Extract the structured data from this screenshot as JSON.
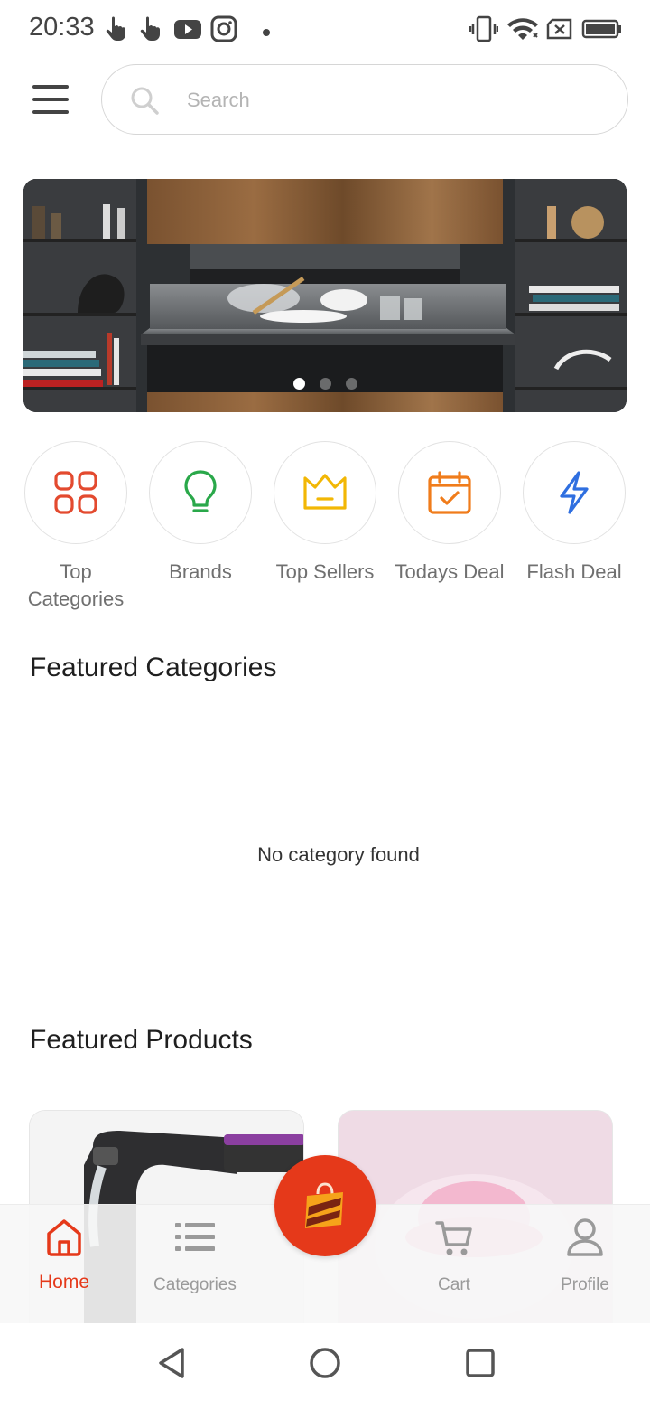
{
  "status_bar": {
    "time": "20:33",
    "left_icons": [
      "touch-icon",
      "touch-icon",
      "youtube-icon",
      "instagram-icon",
      "dot-icon"
    ],
    "right_icons": [
      "vibrate-icon",
      "wifi-icon",
      "no-sim-icon",
      "battery-icon"
    ]
  },
  "header": {
    "menu_icon": "hamburger-menu-icon",
    "search_placeholder": "Search",
    "search_icon": "search-icon"
  },
  "banner": {
    "slide_count": 3,
    "active_slide": 1
  },
  "quick_categories": [
    {
      "label": "Top Categories",
      "icon": "grid-icon",
      "color": "#e34a2f"
    },
    {
      "label": "Brands",
      "icon": "lightbulb-icon",
      "color": "#2aa84a"
    },
    {
      "label": "Top Sellers",
      "icon": "crown-icon",
      "color": "#f2b705"
    },
    {
      "label": "Todays Deal",
      "icon": "calendar-check-icon",
      "color": "#f07c1b"
    },
    {
      "label": "Flash Deal",
      "icon": "lightning-icon",
      "color": "#2f6fe0"
    }
  ],
  "featured_categories": {
    "title": "Featured Categories",
    "empty_text": "No category found"
  },
  "featured_products": {
    "title": "Featured Products"
  },
  "bottom_nav": {
    "items": [
      {
        "label": "Home",
        "icon": "home-icon",
        "active": true
      },
      {
        "label": "Categories",
        "icon": "list-icon",
        "active": false
      },
      {
        "label": "Cart",
        "icon": "cart-icon",
        "active": false
      },
      {
        "label": "Profile",
        "icon": "user-icon",
        "active": false
      }
    ],
    "center_button_icon": "shopping-bag-logo-icon"
  },
  "colors": {
    "accent": "#e5391a",
    "inactive": "#9a9a9a"
  }
}
